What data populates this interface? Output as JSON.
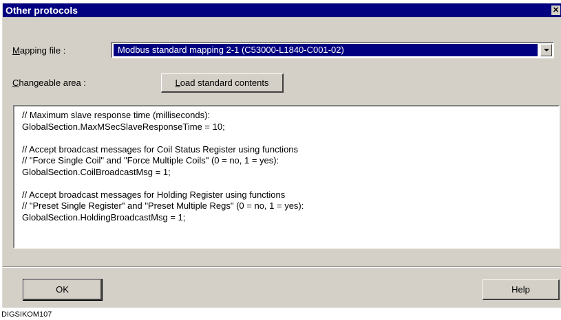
{
  "dialog": {
    "title": "Other protocols",
    "close_glyph": "✕",
    "close_icon": "close-icon"
  },
  "mapping": {
    "label_mnemonic": "M",
    "label_rest": "apping file :",
    "selected": "Modbus standard mapping 2-1 (C53000-L1840-C001-02)",
    "arrow_icon": "chevron-down-icon"
  },
  "changeable": {
    "label_mnemonic": "C",
    "label_rest": "hangeable area :"
  },
  "load_button": {
    "mnemonic": "L",
    "rest": "oad standard contents"
  },
  "content_lines": [
    "// Maximum slave response time (milliseconds):",
    "GlobalSection.MaxMSecSlaveResponseTime = 10;",
    "",
    "// Accept broadcast messages for Coil Status Register using functions",
    "// \"Force Single Coil\" and \"Force Multiple Coils\" (0 = no, 1 = yes):",
    "GlobalSection.CoilBroadcastMsg = 1;",
    "",
    "// Accept broadcast messages for Holding Register using functions",
    "// \"Preset Single Register\" and \"Preset Multiple Regs\" (0 = no, 1 = yes):",
    "GlobalSection.HoldingBroadcastMsg = 1;"
  ],
  "ok_button": "OK",
  "help_button": "Help",
  "caption": "DIGSIKOM107",
  "colors": {
    "titlebar": "#000080",
    "face": "#d4d0c8",
    "selection": "#000080"
  }
}
